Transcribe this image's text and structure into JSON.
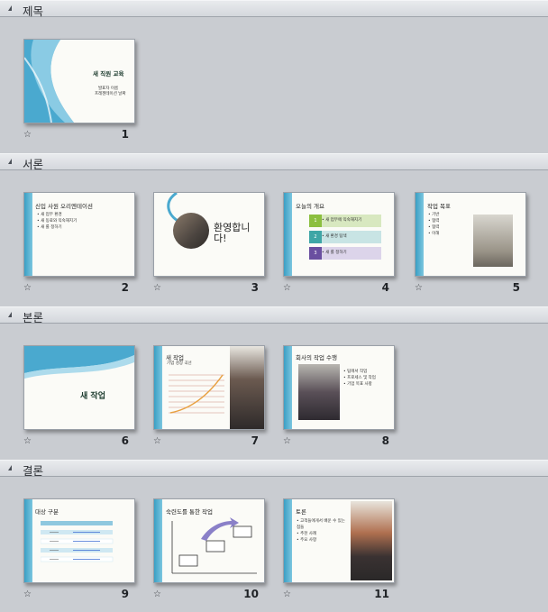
{
  "sections": [
    {
      "title": "제목"
    },
    {
      "title": "서론"
    },
    {
      "title": "본론"
    },
    {
      "title": "결론"
    }
  ],
  "slides": [
    {
      "number": "1",
      "title": "새 직원 교육",
      "sub1": "발표자 이름",
      "sub2": "프레젠테이션 날짜"
    },
    {
      "number": "2",
      "title": "신입 사원 오리엔테이션",
      "bullets": [
        "새 업무 환경",
        "새 동료와 익숙해지기",
        "새 룰 정하기"
      ]
    },
    {
      "number": "3",
      "title": "환영합니다!"
    },
    {
      "number": "4",
      "title": "오늘의 개요",
      "steps": [
        "새 업무에 익숙해지기",
        "새 환경 탐색",
        "새 룰 정하기"
      ],
      "step_nums": [
        "1",
        "2",
        "3"
      ]
    },
    {
      "number": "5",
      "title": "작업 목표",
      "bullets": [
        "기반",
        "협력",
        "협력",
        "이해"
      ]
    },
    {
      "number": "6",
      "title": "새 작업"
    },
    {
      "number": "7",
      "title": "새 작업",
      "subtitle": "기업 성장 곡선"
    },
    {
      "number": "8",
      "title": "회사의 작업 수행",
      "bullets": [
        "팀에서 작업",
        "프로세스 및 작업",
        "기업 목표 사항"
      ]
    },
    {
      "number": "9",
      "title": "대상 구분"
    },
    {
      "number": "10",
      "title": "숙련도를 통한 작업"
    },
    {
      "number": "11",
      "title": "토론",
      "bullets": [
        "고객들에게서 배운 수 있는 점들",
        "추천 사례",
        "주요 사항"
      ]
    }
  ],
  "icons": {
    "star": "star-transition-icon",
    "collapse": "collapse-triangle-icon"
  },
  "colors": {
    "accent": "#3a9fc4",
    "background": "#c9ccd1"
  }
}
